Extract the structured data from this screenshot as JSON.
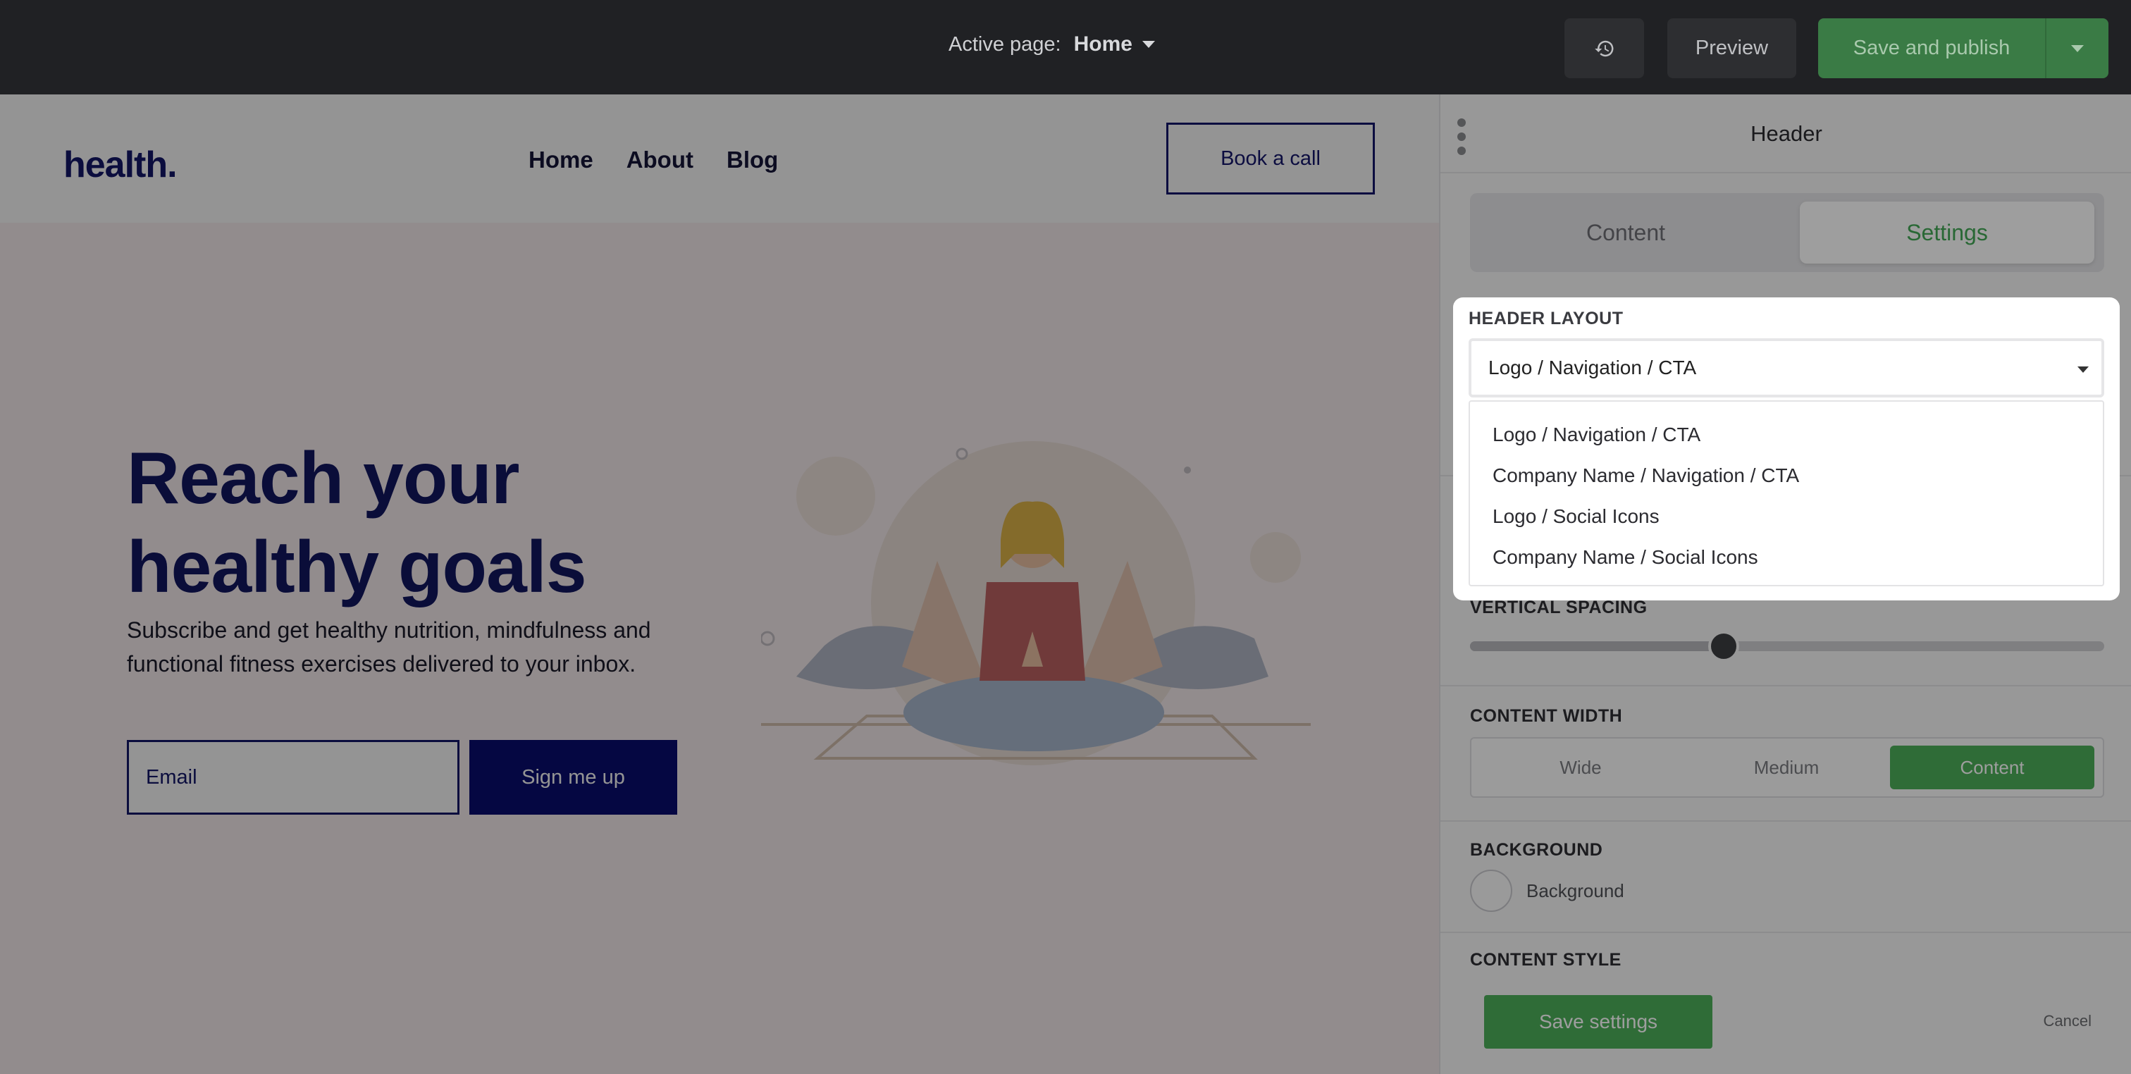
{
  "topbar": {
    "active_page_label": "Active page:",
    "active_page_value": "Home",
    "preview_label": "Preview",
    "publish_label": "Save and publish"
  },
  "site": {
    "logo": "health.",
    "nav": [
      "Home",
      "About",
      "Blog"
    ],
    "cta_label": "Book a call",
    "hero_title": "Reach your healthy goals",
    "hero_subtitle": "Subscribe and get healthy nutrition, mindfulness and functional fitness exercises delivered to your inbox.",
    "email_placeholder": "Email",
    "signup_label": "Sign me up"
  },
  "panel": {
    "title": "Header",
    "tabs": [
      "Content",
      "Settings"
    ],
    "active_tab": "Settings",
    "header_layout": {
      "label": "HEADER LAYOUT",
      "selected": "Logo / Navigation / CTA",
      "options": [
        "Logo / Navigation / CTA",
        "Company Name / Navigation / CTA",
        "Logo / Social Icons",
        "Company Name / Social Icons"
      ]
    },
    "vertical_spacing": {
      "label": "VERTICAL SPACING",
      "value_fraction": 0.4
    },
    "content_width": {
      "label": "CONTENT WIDTH",
      "options": [
        "Wide",
        "Medium",
        "Content"
      ],
      "selected": "Content"
    },
    "background": {
      "label": "BACKGROUND",
      "swatch_label": "Background"
    },
    "content_style": {
      "label": "CONTENT STYLE"
    },
    "save_label": "Save settings",
    "cancel_label": "Cancel"
  },
  "colors": {
    "accent_green": "#4cae5a",
    "brand_navy": "#14186b",
    "topbar_bg": "#202124"
  }
}
